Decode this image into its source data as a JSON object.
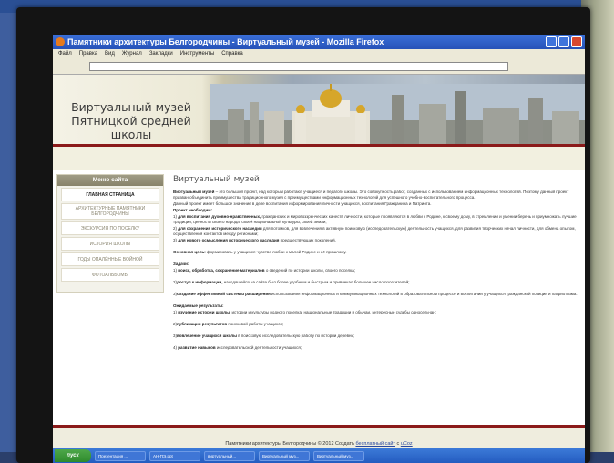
{
  "window": {
    "title": "Памятники архитектуры Белгородчины - Виртуальный музей - Mozilla Firefox",
    "menu": [
      "Файл",
      "Правка",
      "Вид",
      "Журнал",
      "Закладки",
      "Инструменты",
      "Справка"
    ]
  },
  "site": {
    "title_line1": "Виртуальный музей",
    "title_line2": "Пятницкой средней школы"
  },
  "sidebar": {
    "heading": "Меню сайта",
    "items": [
      {
        "label": "ГЛАВНАЯ СТРАНИЦА",
        "active": true
      },
      {
        "label": "АРХИТЕКТУРНЫЕ ПАМЯТНИКИ БЕЛГОРОДЧИНЫ",
        "active": false
      },
      {
        "label": "ЭКСКУРСИЯ ПО ПОСЕЛКУ",
        "active": false
      },
      {
        "label": "ИСТОРИЯ ШКОЛЫ",
        "active": false
      },
      {
        "label": "ГОДЫ ОПАЛЁННЫЕ ВОЙНОЙ",
        "active": false
      },
      {
        "label": "ФОТОАЛЬБОМЫ",
        "active": false
      }
    ]
  },
  "content": {
    "heading": "Виртуальный музей",
    "intro_bold": "Виртуальный музей",
    "intro_text": " – это большой проект, над которым работают учащиеся и педагоги школы. Это совокупность работ, созданных с использованием информационных технологий. Поэтому данный проект призван объединить преимущества традиционного музея с преимуществами информационных технологий для успешного учебно-воспитательного процесса.",
    "para2": "Данный проект имеет большое значение в деле воспитания и формирования личности учащихся, воспитания Гражданина и Патриота.",
    "need_heading": "Проект необходим:",
    "need1_bold": "для воспитания духовно-нравственных,",
    "need1_text": " гражданских и мировоззренческих качеств личности, которые проявляются в любви к Родине, к своему дому, в стремлении и умении беречь и приумножать лучшие традиции, ценности своего народа, своей национальной культуры, своей земли;",
    "need2_bold": "для сохранения исторического наследия",
    "need2_text": " для потомков, для вовлечения в активную поисковую (исследовательскую) деятельность учащихся, для развития творческих начал личности, для обмена опытом, осуществления контактов между регионами;",
    "need3_bold": "для нового осмысления исторического наследия",
    "need3_text": " предшествующих поколений.",
    "goal_bold": "Основная цель:",
    "goal_text": " формировать у учащихся чувство любви к малой Родине и её прошлому.",
    "tasks_heading": "Задачи:",
    "task1_bold": "поиск, обработка, сохранение материалов",
    "task1_text": " о сведений по истории школы, своего поселка;",
    "task2_bold": "доступ к информации,",
    "task2_text": " находящейся на сайте был более удобным и быстрым и привлекал большее число посетителей;",
    "task3_bold": "создание эффективной системы расширения",
    "task3_text": " использования информационных и коммуникационных технологий в образовательном процессе и воспитании у учащихся гражданской позиции и патриотизма.",
    "results_heading": "Ожидаемые результаты:",
    "res1_bold": "изучение истории школы,",
    "res1_text": " истории и культуры родного поселка, национальные традиции и обычаи, интересные судьбы односельчан;",
    "res2_bold": "публикация результатов",
    "res2_text": " поисковой работы учащихся;",
    "res3_bold": "вовлечение учащихся школы",
    "res3_text": " в поисковую исследовательскую работу по истории деревни;",
    "res4_bold": "развитие навыков",
    "res4_text": " исследовательской деятельности учащихся;"
  },
  "footer": {
    "text": "Памятники архитектуры Белгородчины © 2012 Создать ",
    "link1": "бесплатный сайт",
    "mid": " с ",
    "link2": "uCoz"
  },
  "taskbar": {
    "start": "пуск",
    "tasks": [
      "Презентация ...",
      "АН-ПЭ.ppt",
      "виртуальный...",
      "Виртуальный муз...",
      "Виртуальный муз..."
    ]
  },
  "colors": {
    "accent_red": "#8b1a1a",
    "sidebar_head": "#88836a",
    "link": "#2a4aa0"
  }
}
